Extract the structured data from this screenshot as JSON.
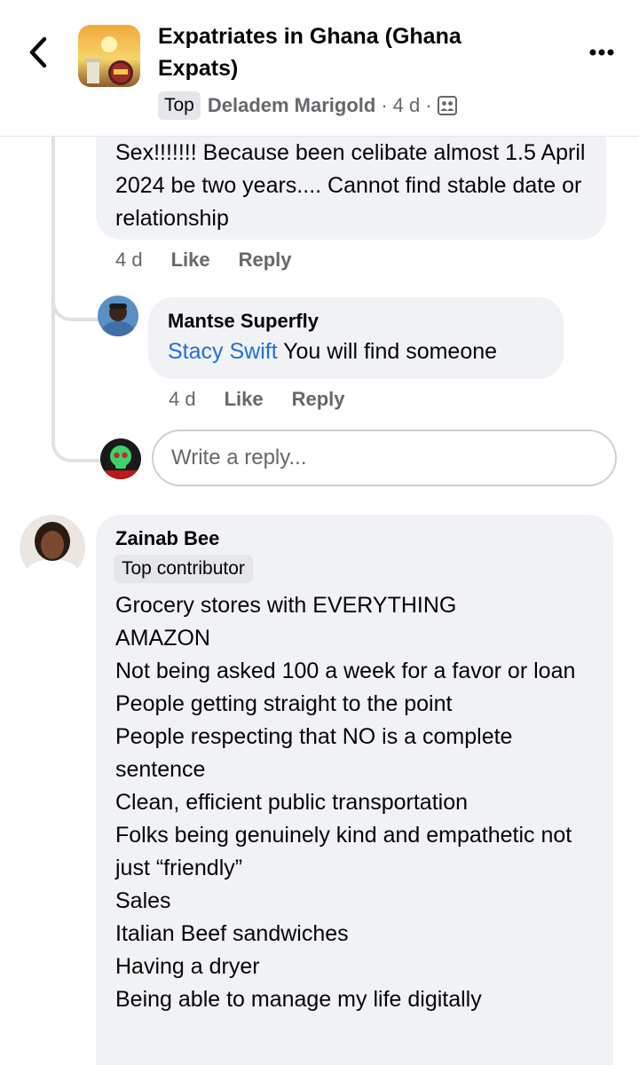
{
  "header": {
    "group_name_line1": "Expatriates in Ghana (Ghana",
    "group_name_line2": "Expats)",
    "filter_chip": "Top",
    "author": "Deladem Marigold",
    "sep1": "·",
    "time": "4 d",
    "sep2": "·",
    "audience_icon": "group-members-icon"
  },
  "comment1": {
    "text": "Sex!!!!!!! Because been celibate almost 1.5 April 2024 be two years.... Cannot find stable date or relationship",
    "time": "4 d",
    "like": "Like",
    "reply": "Reply"
  },
  "comment2": {
    "name": "Mantse Superfly",
    "mention": "Stacy Swift",
    "text": " You will find someone",
    "time": "4 d",
    "like": "Like",
    "reply": "Reply"
  },
  "reply_box": {
    "placeholder": "Write a reply..."
  },
  "comment3": {
    "name": "Zainab Bee",
    "badge": "Top contributor",
    "lines": [
      "Grocery stores with EVERYTHING",
      "AMAZON",
      "Not being asked 100 a week for a favor or loan",
      "People getting straight to the point",
      "People respecting that NO is a complete sentence",
      "Clean, efficient public transportation",
      "Folks being genuinely kind and empathetic not just “friendly”",
      "Sales",
      "Italian Beef sandwiches",
      "Having a dryer",
      "Being able to manage my life digitally"
    ]
  },
  "colors": {
    "bubble": "#f0f2f5",
    "link": "#216fdb",
    "secondary_text": "#65676b"
  }
}
